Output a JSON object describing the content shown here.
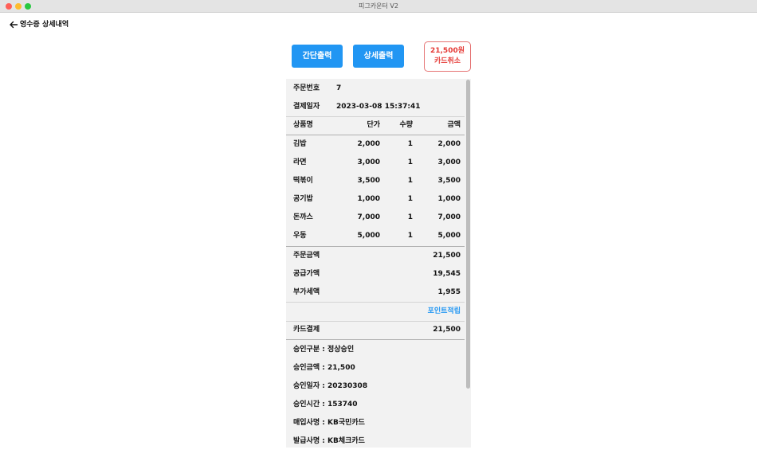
{
  "window": {
    "title": "피그카운터 V2"
  },
  "nav": {
    "back_label": "영수증 상세내역"
  },
  "actions": {
    "simple_print": "간단출력",
    "detail_print": "상세출력",
    "cancel_amount": "21,500원",
    "cancel_label": "카드취소"
  },
  "receipt": {
    "order_no_label": "주문번호",
    "order_no": "7",
    "paid_at_label": "결제일자",
    "paid_at": "2023-03-08 15:37:41",
    "columns": {
      "name": "상품명",
      "price": "단가",
      "qty": "수량",
      "amount": "금액"
    },
    "items": [
      {
        "name": "김밥",
        "price": "2,000",
        "qty": "1",
        "amount": "2,000"
      },
      {
        "name": "라면",
        "price": "3,000",
        "qty": "1",
        "amount": "3,000"
      },
      {
        "name": "떡볶이",
        "price": "3,500",
        "qty": "1",
        "amount": "3,500"
      },
      {
        "name": "공기밥",
        "price": "1,000",
        "qty": "1",
        "amount": "1,000"
      },
      {
        "name": "돈까스",
        "price": "7,000",
        "qty": "1",
        "amount": "7,000"
      },
      {
        "name": "우동",
        "price": "5,000",
        "qty": "1",
        "amount": "5,000"
      }
    ],
    "order_total_label": "주문금액",
    "order_total": "21,500",
    "supply_label": "공급가액",
    "supply": "19,545",
    "vat_label": "부가세액",
    "vat": "1,955",
    "point_link": "포인트적립",
    "card_pay_label": "카드결제",
    "card_pay": "21,500",
    "approval": [
      "승인구분 : 정상승인",
      "승인금액 : 21,500",
      "승인일자 : 20230308",
      "승인시간 : 153740",
      "매입사명 : KB국민카드",
      "발급사명 : KB체크카드"
    ]
  }
}
